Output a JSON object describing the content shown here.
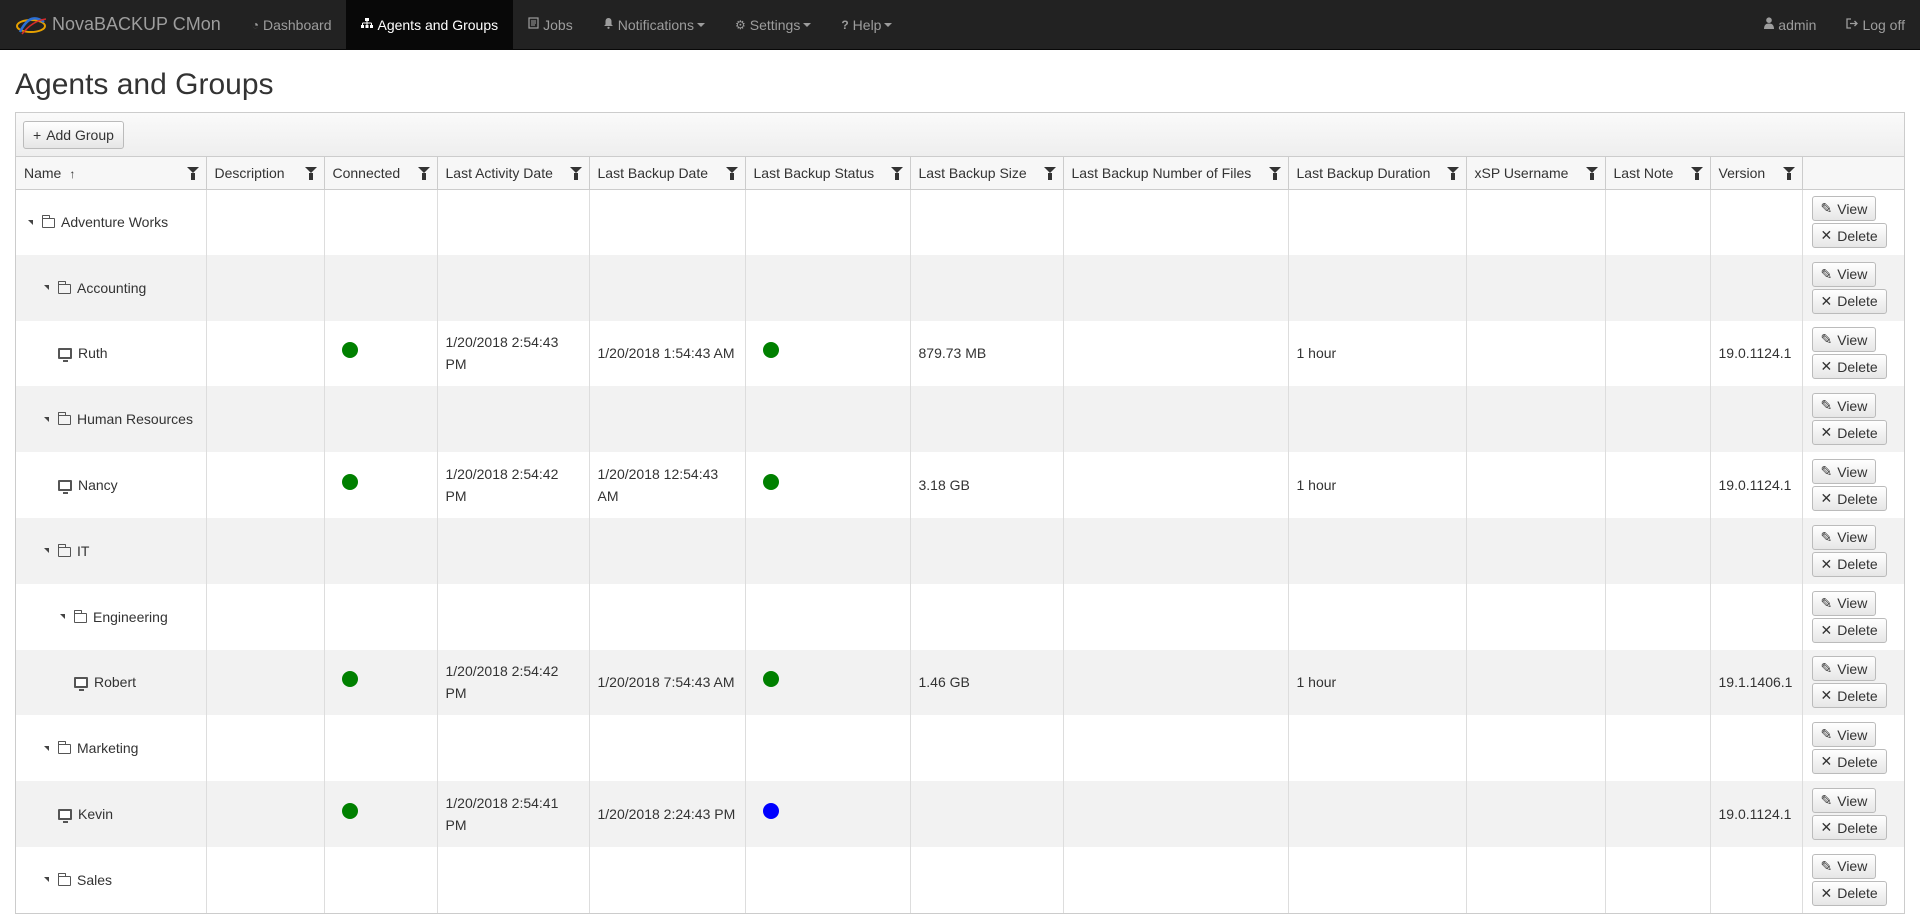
{
  "nav": {
    "brand": "NovaBACKUP CMon",
    "items": [
      {
        "label": "Dashboard",
        "icon": "dashboard-icon",
        "active": false
      },
      {
        "label": "Agents and Groups",
        "icon": "sitemap-icon",
        "active": true
      },
      {
        "label": "Jobs",
        "icon": "jobs-icon",
        "active": false
      },
      {
        "label": "Notifications",
        "icon": "bell-icon",
        "active": false,
        "dropdown": true
      },
      {
        "label": "Settings",
        "icon": "gear-icon",
        "active": false,
        "dropdown": true
      },
      {
        "label": "Help",
        "icon": "question-icon",
        "active": false,
        "dropdown": true
      }
    ],
    "user": "admin",
    "logoff": "Log off"
  },
  "page": {
    "title": "Agents and Groups",
    "add_group": "Add Group"
  },
  "columns": [
    {
      "key": "name",
      "label": "Name",
      "sorted": "asc"
    },
    {
      "key": "description",
      "label": "Description"
    },
    {
      "key": "connected",
      "label": "Connected"
    },
    {
      "key": "last_activity",
      "label": "Last Activity Date"
    },
    {
      "key": "last_backup_date",
      "label": "Last Backup Date"
    },
    {
      "key": "last_backup_status",
      "label": "Last Backup Status"
    },
    {
      "key": "last_backup_size",
      "label": "Last Backup Size"
    },
    {
      "key": "last_backup_files",
      "label": "Last Backup Number of Files"
    },
    {
      "key": "last_backup_duration",
      "label": "Last Backup Duration"
    },
    {
      "key": "xsp_username",
      "label": "xSP Username"
    },
    {
      "key": "last_note",
      "label": "Last Note"
    },
    {
      "key": "version",
      "label": "Version"
    }
  ],
  "actions": {
    "view": "View",
    "delete": "Delete"
  },
  "colors": {
    "success": "#008000",
    "running": "#0000ff"
  },
  "rows": [
    {
      "name": "Adventure Works",
      "type": "group",
      "level": 0
    },
    {
      "name": "Accounting",
      "type": "group",
      "level": 1
    },
    {
      "name": "Ruth",
      "type": "agent",
      "level": 2,
      "connected": "#008000",
      "last_activity": "1/20/2018 2:54:43 PM",
      "last_backup_date": "1/20/2018 1:54:43 AM",
      "status": "#008000",
      "size": "879.73 MB",
      "files": "",
      "duration": "1 hour",
      "xsp": "",
      "note": "",
      "version": "19.0.1124.1"
    },
    {
      "name": "Human Resources",
      "type": "group",
      "level": 1
    },
    {
      "name": "Nancy",
      "type": "agent",
      "level": 2,
      "connected": "#008000",
      "last_activity": "1/20/2018 2:54:42 PM",
      "last_backup_date": "1/20/2018 12:54:43 AM",
      "status": "#008000",
      "size": "3.18 GB",
      "files": "",
      "duration": "1 hour",
      "xsp": "",
      "note": "",
      "version": "19.0.1124.1"
    },
    {
      "name": "IT",
      "type": "group",
      "level": 1
    },
    {
      "name": "Engineering",
      "type": "group",
      "level": 2
    },
    {
      "name": "Robert",
      "type": "agent",
      "level": 3,
      "connected": "#008000",
      "last_activity": "1/20/2018 2:54:42 PM",
      "last_backup_date": "1/20/2018 7:54:43 AM",
      "status": "#008000",
      "size": "1.46 GB",
      "files": "",
      "duration": "1 hour",
      "xsp": "",
      "note": "",
      "version": "19.1.1406.1"
    },
    {
      "name": "Marketing",
      "type": "group",
      "level": 1
    },
    {
      "name": "Kevin",
      "type": "agent",
      "level": 2,
      "connected": "#008000",
      "last_activity": "1/20/2018 2:54:41 PM",
      "last_backup_date": "1/20/2018 2:24:43 PM",
      "status": "#0000ff",
      "size": "",
      "files": "",
      "duration": "",
      "xsp": "",
      "note": "",
      "version": "19.0.1124.1"
    },
    {
      "name": "Sales",
      "type": "group",
      "level": 1
    }
  ]
}
